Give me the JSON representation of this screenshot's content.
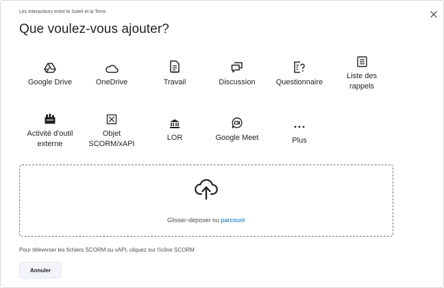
{
  "dialog": {
    "breadcrumb": "Les interactions entre le Soleil et la Terre",
    "title": "Que voulez-vous ajouter?"
  },
  "tiles": [
    {
      "label": "Google Drive",
      "icon": "google-drive-icon"
    },
    {
      "label": "OneDrive",
      "icon": "onedrive-icon"
    },
    {
      "label": "Travail",
      "icon": "assignment-icon"
    },
    {
      "label": "Discussion",
      "icon": "discussion-icon"
    },
    {
      "label": "Questionnaire",
      "icon": "quiz-icon"
    },
    {
      "label": "Liste des rappels",
      "icon": "checklist-icon"
    },
    {
      "label": "Activité d'outil externe",
      "icon": "external-tool-icon"
    },
    {
      "label": "Objet SCORM/xAPI",
      "icon": "scorm-icon"
    },
    {
      "label": "LOR",
      "icon": "lor-icon"
    },
    {
      "label": "Google Meet",
      "icon": "google-meet-icon"
    },
    {
      "label": "Plus",
      "icon": "more-icon"
    }
  ],
  "dropzone": {
    "text": "Glisser-déposer ou",
    "link": "parcourir",
    "icon": "upload-icon"
  },
  "note": "Pour téléverser les fichiers SCORM ou xAPI, cliquez sur l'icône SCORM",
  "buttons": {
    "cancel": "Annuler"
  }
}
